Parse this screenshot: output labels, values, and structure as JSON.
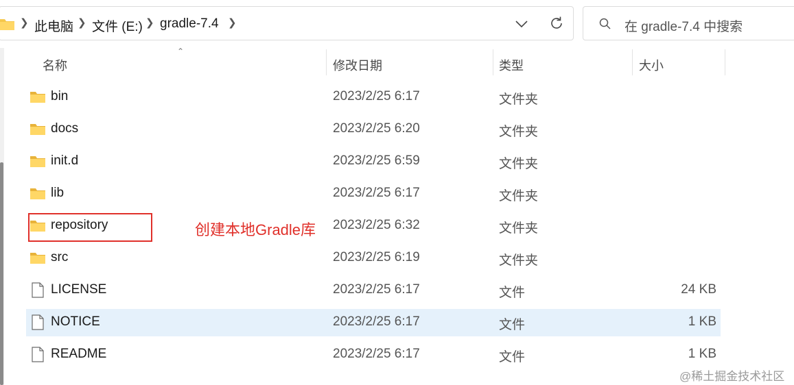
{
  "address_bar": {
    "breadcrumbs": [
      "此电脑",
      "文件 (E:)",
      "gradle-7.4"
    ],
    "folder_icon": "folder-icon",
    "dropdown_icon": "chevron-down-icon",
    "refresh_icon": "refresh-icon"
  },
  "search": {
    "placeholder": "在 gradle-7.4 中搜索",
    "icon": "search-icon"
  },
  "columns": {
    "name": "名称",
    "date": "修改日期",
    "type": "类型",
    "size": "大小"
  },
  "files": [
    {
      "name": "bin",
      "date": "2023/2/25 6:17",
      "type": "文件夹",
      "size": "",
      "icon": "folder-icon"
    },
    {
      "name": "docs",
      "date": "2023/2/25 6:20",
      "type": "文件夹",
      "size": "",
      "icon": "folder-icon"
    },
    {
      "name": "init.d",
      "date": "2023/2/25 6:59",
      "type": "文件夹",
      "size": "",
      "icon": "folder-icon"
    },
    {
      "name": "lib",
      "date": "2023/2/25 6:17",
      "type": "文件夹",
      "size": "",
      "icon": "folder-icon"
    },
    {
      "name": "repository",
      "date": "2023/2/25 6:32",
      "type": "文件夹",
      "size": "",
      "icon": "folder-icon"
    },
    {
      "name": "src",
      "date": "2023/2/25 6:19",
      "type": "文件夹",
      "size": "",
      "icon": "folder-icon"
    },
    {
      "name": "LICENSE",
      "date": "2023/2/25 6:17",
      "type": "文件",
      "size": "24 KB",
      "icon": "file-icon"
    },
    {
      "name": "NOTICE",
      "date": "2023/2/25 6:17",
      "type": "文件",
      "size": "1 KB",
      "icon": "file-icon"
    },
    {
      "name": "README",
      "date": "2023/2/25 6:17",
      "type": "文件",
      "size": "1 KB",
      "icon": "file-icon"
    }
  ],
  "selected_file": "NOTICE",
  "annotation": {
    "text": "创建本地Gradle库",
    "color": "#e0302a"
  },
  "watermark": "@稀土掘金技术社区",
  "colors": {
    "selection": "#e5f1fb",
    "folder": "#f5c84c"
  }
}
